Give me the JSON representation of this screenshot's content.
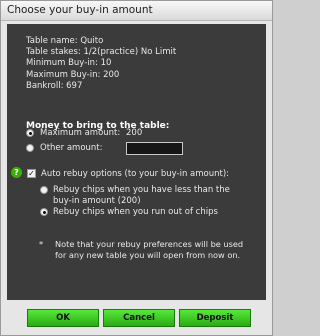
{
  "window": {
    "title": "Choose your buy-in amount"
  },
  "info": {
    "table_name": "Table name: Quito",
    "table_stakes": "Table stakes: 1/2(practice) No Limit",
    "min_buyin": "Minimum Buy-in: 10",
    "max_buyin": "Maximum Buy-in: 200",
    "bankroll": "Bankroll: 697"
  },
  "money": {
    "heading": "Money to bring to the table:",
    "max_label": "Maximum amount:",
    "max_value": "200",
    "other_label": "Other amount:",
    "other_value": "",
    "selected": "max"
  },
  "rebuy": {
    "checkbox_label": "Auto rebuy options (to your buy-in amount):",
    "checked": true,
    "option1_line1": "Rebuy chips when you have less than the",
    "option1_line2": "buy-in amount (200)",
    "option2": "Rebuy chips when you run out of chips",
    "selected": "option2"
  },
  "note": {
    "star": "*",
    "line1": "Note that your rebuy preferences will be used",
    "line2": "for any new table you will open from now on."
  },
  "buttons": {
    "ok": "OK",
    "cancel": "Cancel",
    "deposit": "Deposit"
  },
  "colors": {
    "button_green": "#3cc41f",
    "panel_bg": "#3b3b3b",
    "help_green": "#3ab000"
  }
}
